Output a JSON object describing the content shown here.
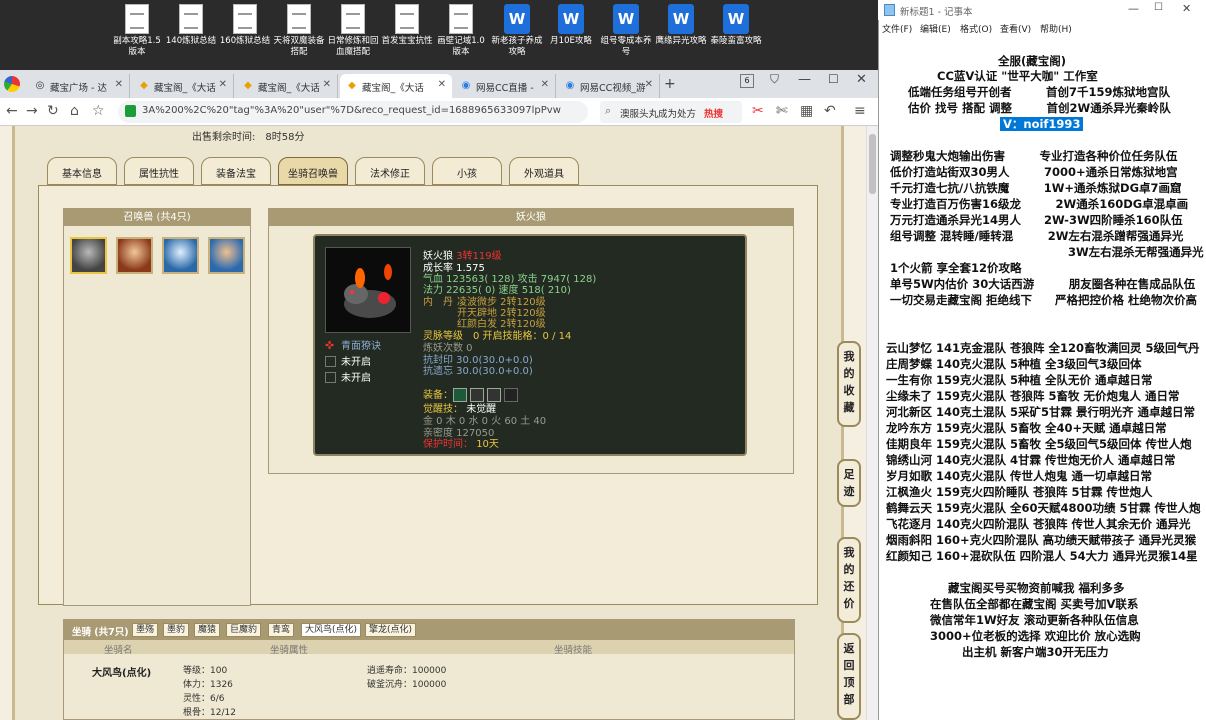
{
  "desktop": {
    "icons": [
      {
        "label": "副本攻略1.5版本",
        "type": "doc"
      },
      {
        "label": "140炼狱总结",
        "type": "doc"
      },
      {
        "label": "160炼狱总结",
        "type": "doc"
      },
      {
        "label": "天将双魔装备搭配",
        "type": "doc"
      },
      {
        "label": "日常修炼和回血魔搭配",
        "type": "doc"
      },
      {
        "label": "首发宝宝抗性",
        "type": "doc"
      },
      {
        "label": "画壁记域1.0版本",
        "type": "doc"
      },
      {
        "label": "新老孩子养成攻略",
        "type": "wps"
      },
      {
        "label": "月10E攻略",
        "type": "wps"
      },
      {
        "label": "组号零成本养号",
        "type": "wps"
      },
      {
        "label": "鹰缘异光攻略",
        "type": "wps"
      },
      {
        "label": "秦陵蛮富攻略",
        "type": "wps"
      }
    ]
  },
  "browser": {
    "tabs": [
      {
        "label": "藏宝广场 - 达",
        "active": false
      },
      {
        "label": "藏宝阁_《大话",
        "active": false
      },
      {
        "label": "藏宝阁_《大话",
        "active": false
      },
      {
        "label": "藏宝阁_《大话",
        "active": true
      },
      {
        "label": "网易CC直播 -",
        "active": false
      },
      {
        "label": "网易CC视频_游",
        "active": false
      }
    ],
    "tab_count": "6",
    "url": "3A%200%2C%20\"tag\"%3A%20\"user\"%7D&reco_request_id=1688965633097lpPvw",
    "search_text": "澳服头丸成为处方",
    "search_hot": "热搜"
  },
  "game": {
    "remaining_label": "出售剩余时间:",
    "remaining_value": "8时58分",
    "tabs": [
      "基本信息",
      "属性抗性",
      "装备法宝",
      "坐骑召唤兽",
      "法术修正",
      "小孩",
      "外观道具"
    ],
    "selected_tab": 3,
    "pet_panel_title": "召唤兽 (共4只)",
    "detail_title": "妖火狼",
    "pet": {
      "name_label": "妖火狼",
      "name_value": "3转119级",
      "growth": "成长率 1.575",
      "hp_line": "气血 123563( 128) 攻击 7947( 128)",
      "mp_line": "法力 22635( 0) 速度 518( 210)",
      "inner_label": "内　丹",
      "inner1": "凌波微步 2转120级",
      "inner2": "开天辟地 2转120级",
      "inner3": "红颜白发 2转120级",
      "soul_level": "灵脉等级　0 开启技能格：0 / 14",
      "refine": "炼妖次数 0",
      "resist_seal": "抗封印 30.0(30.0+0.0)",
      "resist_forget": "抗遗忘 30.0(30.0+0.0)",
      "equip_label": "装备：",
      "awaken_label": "觉醒技：",
      "awaken_value": "未觉醒",
      "elements": "金 0 木 0 水 0 火 60 土 40",
      "intimacy": "亲密度 127050",
      "protect_label": "保护时间：",
      "protect_value": "10天",
      "skill1": "青面獠诀",
      "skill2": "未开启",
      "skill3": "未开启"
    },
    "mount_panel_title": "坐骑 (共7只)",
    "mount_tabs": [
      "墨殇",
      "墨豹",
      "魔猿",
      "巨魔豹",
      "青鸾",
      "大风鸟(点化)",
      "擎龙(点化)"
    ],
    "mount_headers": [
      "坐骑名",
      "坐骑属性",
      "坐骑技能"
    ],
    "mount": {
      "name": "大风鸟(点化)",
      "level": "等级：100",
      "stamina": "体力：1326",
      "spirit": "灵性：6/6",
      "root": "根骨：12/12",
      "skill1": "逍遥寿命：100000",
      "skill2": "破釜沉舟：100000"
    },
    "sidebar_buttons": [
      "我的收藏",
      "足迹",
      "我的还价",
      "返回顶部"
    ]
  },
  "notepad": {
    "title": "新标题1 - 记事本",
    "menu": [
      "文件(F)",
      "编辑(E)",
      "格式(O)",
      "查看(V)",
      "帮助(H)"
    ],
    "lines": [
      "全服(藏宝阁)",
      "CC蓝V认证 \"世平大咖\" 工作室",
      "低端任务组号开创者　　　首创7千159炼狱地宫队",
      "估价 找号 搭配 调整　　　首创2W通杀异光秦岭队",
      "V：noif1993",
      "调整秒鬼大炮输出伤害　　　专业打造各种价位任务队伍",
      "低价打造站街双30男人　　　7000+通杀日常炼狱地宫",
      "千元打造七抗/八抗铁魔　　　1W+通杀炼狱DG卓7画窟",
      "专业打造百万伤害16级龙　　　2W通杀160DG卓混卓画",
      "万元打造通杀异光14男人　　2W-3W四阶睡杀160队伍",
      "组号调整 混转睡/睡转混　　　2W左右混杀蹭帮强通异光",
      "3W左右混杀无帮强通异光",
      "1个火箭 享全套12价攻略",
      "单号5W内估价 30大话西游　　　朋友圈各种在售成品队伍",
      "一切交易走藏宝阁 拒绝线下　　严格把控价格 杜绝物次价高",
      "云山梦忆 141克金混队 苍狼阵 全120畜牧满回灵 5级回气丹",
      "庄周梦蝶 140克火混队 5种植 全3级回气3级回体",
      "一生有你 159克火混队 5种植 全队无价 通卓越日常",
      "尘缘未了 159克火混队 苍狼阵 5畜牧 无价炮鬼人 通日常",
      "河北新区 140克土混队 5采矿5甘霖 景行明光齐 通卓越日常",
      "龙吟东方 159克火混队 5畜牧 全40+天赋 通卓越日常",
      "佳期良年 159克火混队 5畜牧 全5级回气5级回体 传世人炮",
      "锦绣山河 140克火混队 4甘霖 传世炮无价人 通卓越日常",
      "岁月如歌 140克火混队 传世人炮鬼 通一切卓越日常",
      "江枫渔火 159克火四阶睡队 苍狼阵 5甘霖 传世炮人",
      "鹤舞云天 159克火混队 全60天赋4800功绩 5甘霖 传世人炮",
      "飞花逐月 140克火四阶混队 苍狼阵 传世人其余无价 通异光",
      "烟雨斜阳 160+克火四阶混队 高功绩天赋带孩子 通异光灵猴",
      "红颜知己 160+混砍队伍 四阶混人 54大力 通异光灵猴14星",
      "藏宝阁买号买物资前喊我 福利多多",
      "在售队伍全部都在藏宝阁 买卖号加V联系",
      "微信常年1W好友 滚动更新各种队伍信息",
      "3000+位老板的选择 欢迎比价 放心选购",
      "出主机 新客户端30开无压力"
    ]
  }
}
